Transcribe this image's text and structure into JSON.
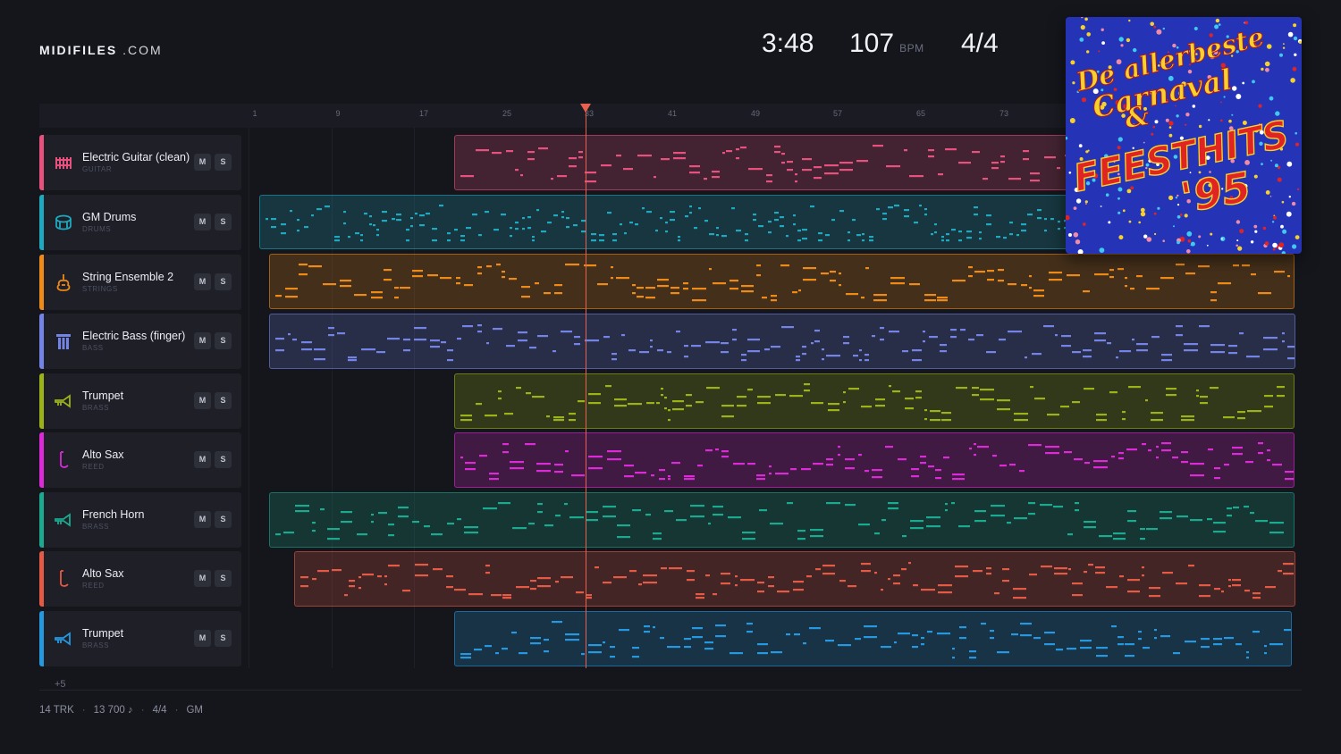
{
  "app": {
    "logo_bold": "MIDIFILES",
    "logo_light": ".COM"
  },
  "stats": {
    "duration": "3:48",
    "bpm": "107",
    "bpm_unit": "BPM",
    "time_signature": "4/4"
  },
  "ruler": {
    "ticks": [
      "1",
      "9",
      "17",
      "25",
      "33",
      "41",
      "49",
      "57",
      "65",
      "73"
    ]
  },
  "tracks": [
    {
      "name": "Electric Guitar (clean)",
      "category": "GUITAR",
      "color": "#e8507e",
      "icon": "guitar-icon",
      "mute": "M",
      "solo": "S"
    },
    {
      "name": "GM Drums",
      "category": "DRUMS",
      "color": "#1fa9c0",
      "icon": "drum-icon",
      "mute": "M",
      "solo": "S"
    },
    {
      "name": "String Ensemble 2",
      "category": "STRINGS",
      "color": "#ee8a18",
      "icon": "violin-icon",
      "mute": "M",
      "solo": "S"
    },
    {
      "name": "Electric Bass (finger)",
      "category": "BASS",
      "color": "#7383e6",
      "icon": "bass-icon",
      "mute": "M",
      "solo": "S"
    },
    {
      "name": "Trumpet",
      "category": "BRASS",
      "color": "#9cb219",
      "icon": "trumpet-icon",
      "mute": "M",
      "solo": "S"
    },
    {
      "name": "Alto Sax",
      "category": "REED",
      "color": "#dd2ad8",
      "icon": "sax-icon",
      "mute": "M",
      "solo": "S"
    },
    {
      "name": "French Horn",
      "category": "BRASS",
      "color": "#1ba98f",
      "icon": "horn-icon",
      "mute": "M",
      "solo": "S"
    },
    {
      "name": "Alto Sax",
      "category": "REED",
      "color": "#e55a45",
      "icon": "sax-icon",
      "mute": "M",
      "solo": "S"
    },
    {
      "name": "Trumpet",
      "category": "BRASS",
      "color": "#2598e0",
      "icon": "trumpet-icon",
      "mute": "M",
      "solo": "S"
    }
  ],
  "more_tracks": "+5",
  "footer": {
    "tracks": "14 TRK",
    "notes": "13 700 ♪",
    "time_signature": "4/4",
    "standard": "GM"
  },
  "album_cover": {
    "line1": "De allerbeste",
    "line2": "Carnaval",
    "amp": "&",
    "line3": "FEESTHITS",
    "line4": "'95"
  }
}
